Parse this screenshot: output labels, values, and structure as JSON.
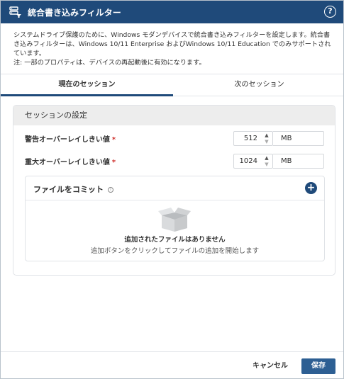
{
  "dialog": {
    "title": "統合書き込みフィルター",
    "help_symbol": "?"
  },
  "description": {
    "line1": "システムドライブ保護のために、Windows モダンデバイスで統合書き込みフィルターを設定します。統合書き込みフィルターは、Windows 10/11 Enterprise およびWindows 10/11 Education でのみサポートされています。",
    "note": "注: 一部のプロパティは、デバイスの再起動後に有効になります。"
  },
  "tabs": [
    {
      "label": "現在のセッション",
      "active": true
    },
    {
      "label": "次のセッション",
      "active": false
    }
  ],
  "session": {
    "header": "セッションの設定",
    "warning_threshold": {
      "label": "警告オーバーレイしきい値",
      "required_mark": "*",
      "value": "512",
      "unit": "MB"
    },
    "critical_threshold": {
      "label": "重大オーバーレイしきい値",
      "required_mark": "*",
      "value": "1024",
      "unit": "MB"
    }
  },
  "commit_files": {
    "title": "ファイルをコミット",
    "info_symbol": "i",
    "add_symbol": "+",
    "empty_title": "追加されたファイルはありません",
    "empty_sub": "追加ボタンをクリックしてファイルの追加を開始します"
  },
  "footer": {
    "cancel_label": "キャンセル",
    "save_label": "保存"
  },
  "colors": {
    "title_bar": "#1f4a7a",
    "primary_button": "#2d5f93",
    "required": "#d0312d"
  }
}
